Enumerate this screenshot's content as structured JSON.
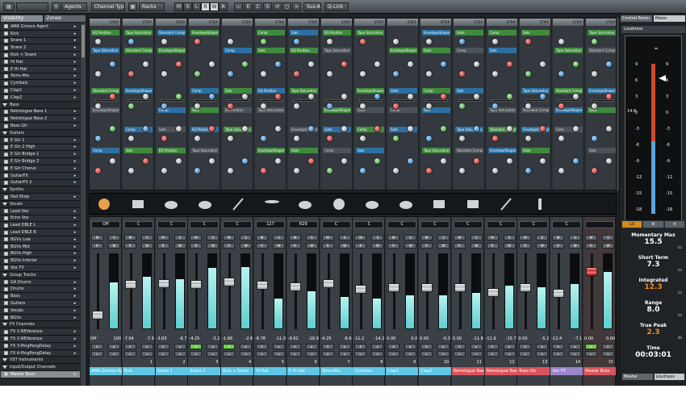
{
  "toolbar": {
    "agents": "Agents",
    "channel_types": "Channel Types",
    "racks": "Racks",
    "msl": [
      "M",
      "S",
      "L",
      "R",
      "W",
      "A"
    ],
    "e": "E",
    "cs": "C",
    "sus_abc": "Sus-Abc",
    "q_link": "Q-Link"
  },
  "left_panel": {
    "tabs": [
      "Visibility",
      "Zones"
    ],
    "tracks": [
      {
        "name": "AMA Groove Agent",
        "type": "track"
      },
      {
        "name": "Kick",
        "type": "track"
      },
      {
        "name": "Snare 1",
        "type": "track"
      },
      {
        "name": "Snare 2",
        "type": "track"
      },
      {
        "name": "Kick + Snare",
        "type": "track"
      },
      {
        "name": "Hi Hat",
        "type": "track"
      },
      {
        "name": "E Hi Hat",
        "type": "track"
      },
      {
        "name": "Toms-Mix",
        "type": "track"
      },
      {
        "name": "Cymbals",
        "type": "track"
      },
      {
        "name": "Clap1",
        "type": "track"
      },
      {
        "name": "Clap2",
        "type": "track"
      },
      {
        "name": "Bass",
        "type": "folder"
      },
      {
        "name": "Retrologue Bass 1",
        "type": "track"
      },
      {
        "name": "Retrologue Bass 2",
        "type": "track"
      },
      {
        "name": "Bass Gtr",
        "type": "track"
      },
      {
        "name": "Guitars",
        "type": "folder"
      },
      {
        "name": "E Gtr 1",
        "type": "track"
      },
      {
        "name": "E Gtr 2 High",
        "type": "track"
      },
      {
        "name": "E Gtr Bridge 1",
        "type": "track"
      },
      {
        "name": "E Gtr Bridge 2",
        "type": "track"
      },
      {
        "name": "E Gtr Chorus",
        "type": "track"
      },
      {
        "name": "GuitarFX",
        "type": "track"
      },
      {
        "name": "GuitarFX 2",
        "type": "track"
      },
      {
        "name": "Synths",
        "type": "folder"
      },
      {
        "name": "Pad Shop",
        "type": "track"
      },
      {
        "name": "Vocals",
        "type": "folder"
      },
      {
        "name": "Lead Vox",
        "type": "track"
      },
      {
        "name": "Echo Vox",
        "type": "track"
      },
      {
        "name": "Lead DBLE L",
        "type": "track"
      },
      {
        "name": "Lead DBLE R",
        "type": "track"
      },
      {
        "name": "BGVs Low",
        "type": "track"
      },
      {
        "name": "BGVs Mid",
        "type": "track"
      },
      {
        "name": "BGVs High",
        "type": "track"
      },
      {
        "name": "BGVs Interior",
        "type": "track"
      },
      {
        "name": "Vox FX",
        "type": "track"
      },
      {
        "name": "Group Tracks",
        "type": "folder"
      },
      {
        "name": "GA Drums",
        "type": "track"
      },
      {
        "name": "Drums",
        "type": "track"
      },
      {
        "name": "Bass",
        "type": "track"
      },
      {
        "name": "Guitars",
        "type": "track"
      },
      {
        "name": "Vocals",
        "type": "track"
      },
      {
        "name": "BGVs",
        "type": "track"
      },
      {
        "name": "FX Channels",
        "type": "folder"
      },
      {
        "name": "FX 1-REVerence",
        "type": "track"
      },
      {
        "name": "FX 2-REVerence",
        "type": "track"
      },
      {
        "name": "FX 3-PingPongDelay",
        "type": "track"
      },
      {
        "name": "FX 4-PingPongDelay",
        "type": "track"
      },
      {
        "name": "VST Instruments",
        "type": "folder"
      },
      {
        "name": "Input/Output Channels",
        "type": "folder"
      },
      {
        "name": "Master Buss",
        "type": "selected"
      }
    ]
  },
  "rack": {
    "strip_label": "STRIP",
    "plugins": [
      "EQ Position",
      "Tape Saturation",
      "Standard Compressor",
      "EnvelopeShaper",
      "Gate",
      "Comp",
      "Sats"
    ]
  },
  "mixer": {
    "strips": [
      {
        "pan": "Off",
        "left": "Off",
        "right": "100",
        "num": "",
        "name": "AMA Groove Ag",
        "color": "cyan",
        "fader": 0.15,
        "meter": 0.62
      },
      {
        "pan": "C",
        "left": "-7.04",
        "right": "-7.9",
        "num": "1",
        "name": "Kick",
        "color": "cyan",
        "fader": 0.6,
        "meter": 0.7
      },
      {
        "pan": "C",
        "left": "-3.83",
        "right": "-6.7",
        "num": "2",
        "name": "Snare 1",
        "color": "cyan",
        "fader": 0.62,
        "meter": 0.66
      },
      {
        "pan": "C",
        "left": "-4.25",
        "right": "-3.2",
        "num": "3",
        "name": "Snare 2",
        "color": "cyan",
        "fader": 0.6,
        "meter": 0.82
      },
      {
        "pan": "C",
        "left": "-1.66",
        "right": "-2.6",
        "num": "4",
        "name": "Kick + Snare",
        "color": "cyan",
        "fader": 0.64,
        "meter": 0.83
      },
      {
        "pan": "127",
        "left": "-8.78",
        "right": "-11.0",
        "num": "5",
        "name": "Hi Hat",
        "color": "cyan",
        "fader": 0.59,
        "meter": 0.4
      },
      {
        "pan": "R29",
        "left": "-9.62",
        "right": "-16.9",
        "num": "6",
        "name": "E Hi Hat",
        "color": "cyan",
        "fader": 0.57,
        "meter": 0.5
      },
      {
        "pan": "C",
        "left": "-4.25",
        "right": "-6.9",
        "num": "7",
        "name": "Toms-Mix",
        "color": "cyan",
        "fader": 0.61,
        "meter": 0.42
      },
      {
        "pan": "C",
        "left": "-11.2",
        "right": "-14.2",
        "num": "8",
        "name": "Cymbals",
        "color": "cyan",
        "fader": 0.53,
        "meter": 0.4
      },
      {
        "pan": "C",
        "left": "0.00",
        "right": "0.0",
        "num": "9",
        "name": "Clap1",
        "color": "cyan",
        "fader": 0.55,
        "meter": 0.45
      },
      {
        "pan": "C",
        "left": "0.00",
        "right": "-0.3",
        "num": "10",
        "name": "Clap2",
        "color": "cyan",
        "fader": 0.55,
        "meter": 0.45
      },
      {
        "pan": "C",
        "left": "0.00",
        "right": "-11.8",
        "num": "11",
        "name": "Retrologue Bass",
        "color": "red",
        "fader": 0.55,
        "meter": 0.48
      },
      {
        "pan": "C",
        "left": "-11.9",
        "right": "-15.7",
        "num": "12",
        "name": "Retrologue Bass",
        "color": "red",
        "fader": 0.48,
        "meter": 0.58
      },
      {
        "pan": "C",
        "left": "0.00",
        "right": "-5.2",
        "num": "13",
        "name": "Bass Gtr",
        "color": "red",
        "fader": 0.55,
        "meter": 0.55
      },
      {
        "pan": "C",
        "left": "-12.4",
        "right": "-7.1",
        "num": "14",
        "name": "Vox FX",
        "color": "purple",
        "fader": 0.47,
        "meter": 0.6
      },
      {
        "pan": "",
        "left": "0.00",
        "right": "0.00",
        "num": "15",
        "name": "Master Buss",
        "color": "red-master",
        "fader": 0.8,
        "meter": 0.76
      }
    ],
    "strip_numbers_extra": [
      "31"
    ]
  },
  "right_panel": {
    "tabs": [
      "Control Room",
      "Meter"
    ],
    "section_title": "Loudness",
    "scale": [
      "9",
      "6",
      "3",
      "0",
      "-3",
      "-6",
      "-9",
      "-12",
      "-15",
      "-18"
    ],
    "scale_right": [
      "9",
      "6",
      "3",
      "0",
      "-3",
      "-6",
      "-9",
      "-12",
      "-15",
      "-18"
    ],
    "side_value": "14.6",
    "controls": [
      "LU",
      "⚙",
      "≡"
    ],
    "stats": [
      {
        "label": "Momentary Max",
        "value": "15.5",
        "unit": "LU",
        "orange": false
      },
      {
        "label": "Short Term",
        "value": "7.3",
        "unit": "LU",
        "orange": false
      },
      {
        "label": "Integrated",
        "value": "12.3",
        "unit": "LU",
        "orange": true
      },
      {
        "label": "Range",
        "value": "8.0",
        "unit": "LU",
        "orange": false
      },
      {
        "label": "True Peak",
        "value": "2.3",
        "unit": "dB",
        "orange": true
      },
      {
        "label": "Time",
        "value": "00:03:01",
        "unit": "",
        "orange": false
      }
    ],
    "bottom_tabs": [
      "Master",
      "Loudness"
    ]
  },
  "colors": {
    "cyan": "#5fc6e4",
    "red": "#d9545b",
    "purple": "#9a86c9",
    "orange": "#f28c2b",
    "green_plugin": "#3f8a3e",
    "blue_plugin": "#2c6fa0"
  }
}
